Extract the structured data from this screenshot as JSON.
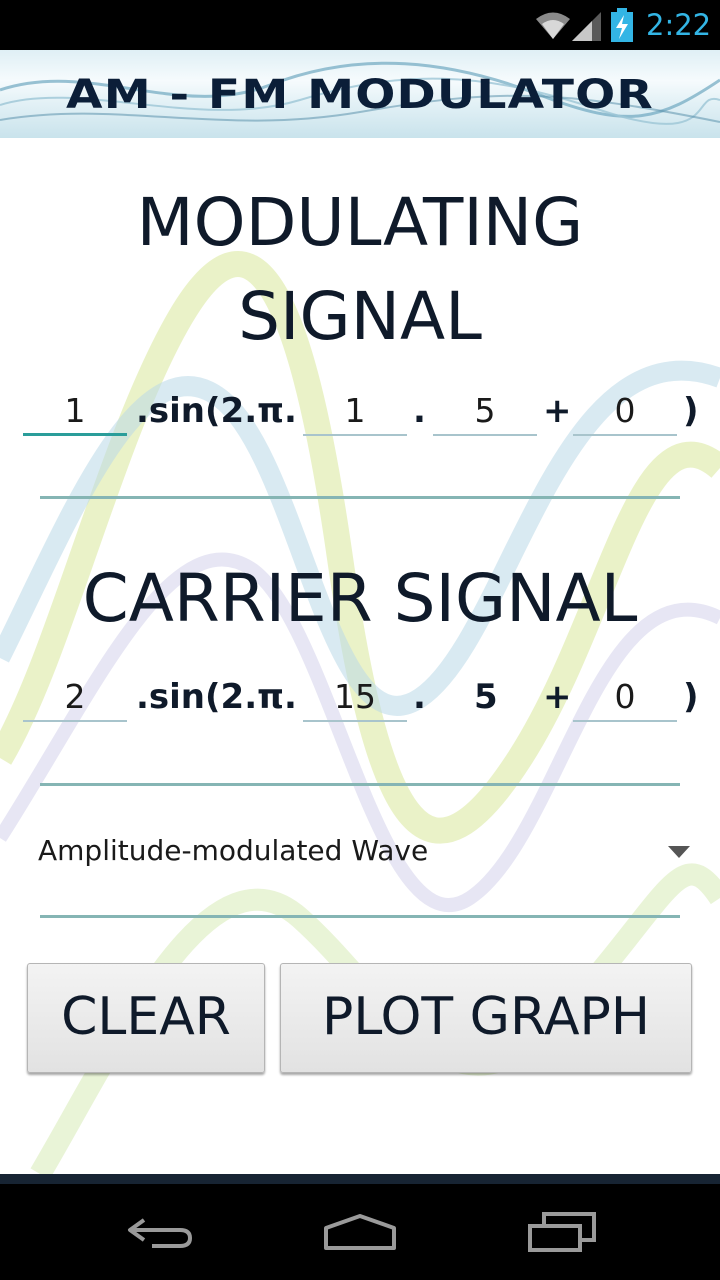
{
  "status_bar": {
    "time": "2:22",
    "icons": [
      "wifi-icon",
      "cell-signal-icon",
      "battery-charging-icon"
    ],
    "accent_color": "#33b5e5"
  },
  "banner": {
    "title": "AM - FM MODULATOR"
  },
  "modulating": {
    "heading": "MODULATING SIGNAL",
    "amplitude": "1",
    "sin_label": ".sin(2.π.",
    "freq_int": "1",
    "dot": ".",
    "freq_frac": "5",
    "plus": "+",
    "phase": "0",
    "close": ")"
  },
  "carrier": {
    "heading": "CARRIER SIGNAL",
    "amplitude": "2",
    "sin_label": ".sin(2.π.",
    "freq_int": "15",
    "dot": ".",
    "freq_frac": "5",
    "plus": "+",
    "phase": "0",
    "close": ")"
  },
  "wave_type": {
    "selected": "Amplitude-modulated Wave"
  },
  "buttons": {
    "clear": "CLEAR",
    "plot": "PLOT GRAPH"
  },
  "navigation": {
    "icons": [
      "back-icon",
      "home-icon",
      "recent-apps-icon"
    ]
  },
  "colors": {
    "field_focus": "#2a9d9a",
    "divider": "#85b5b4",
    "heading_text": "#0f1a2a"
  }
}
